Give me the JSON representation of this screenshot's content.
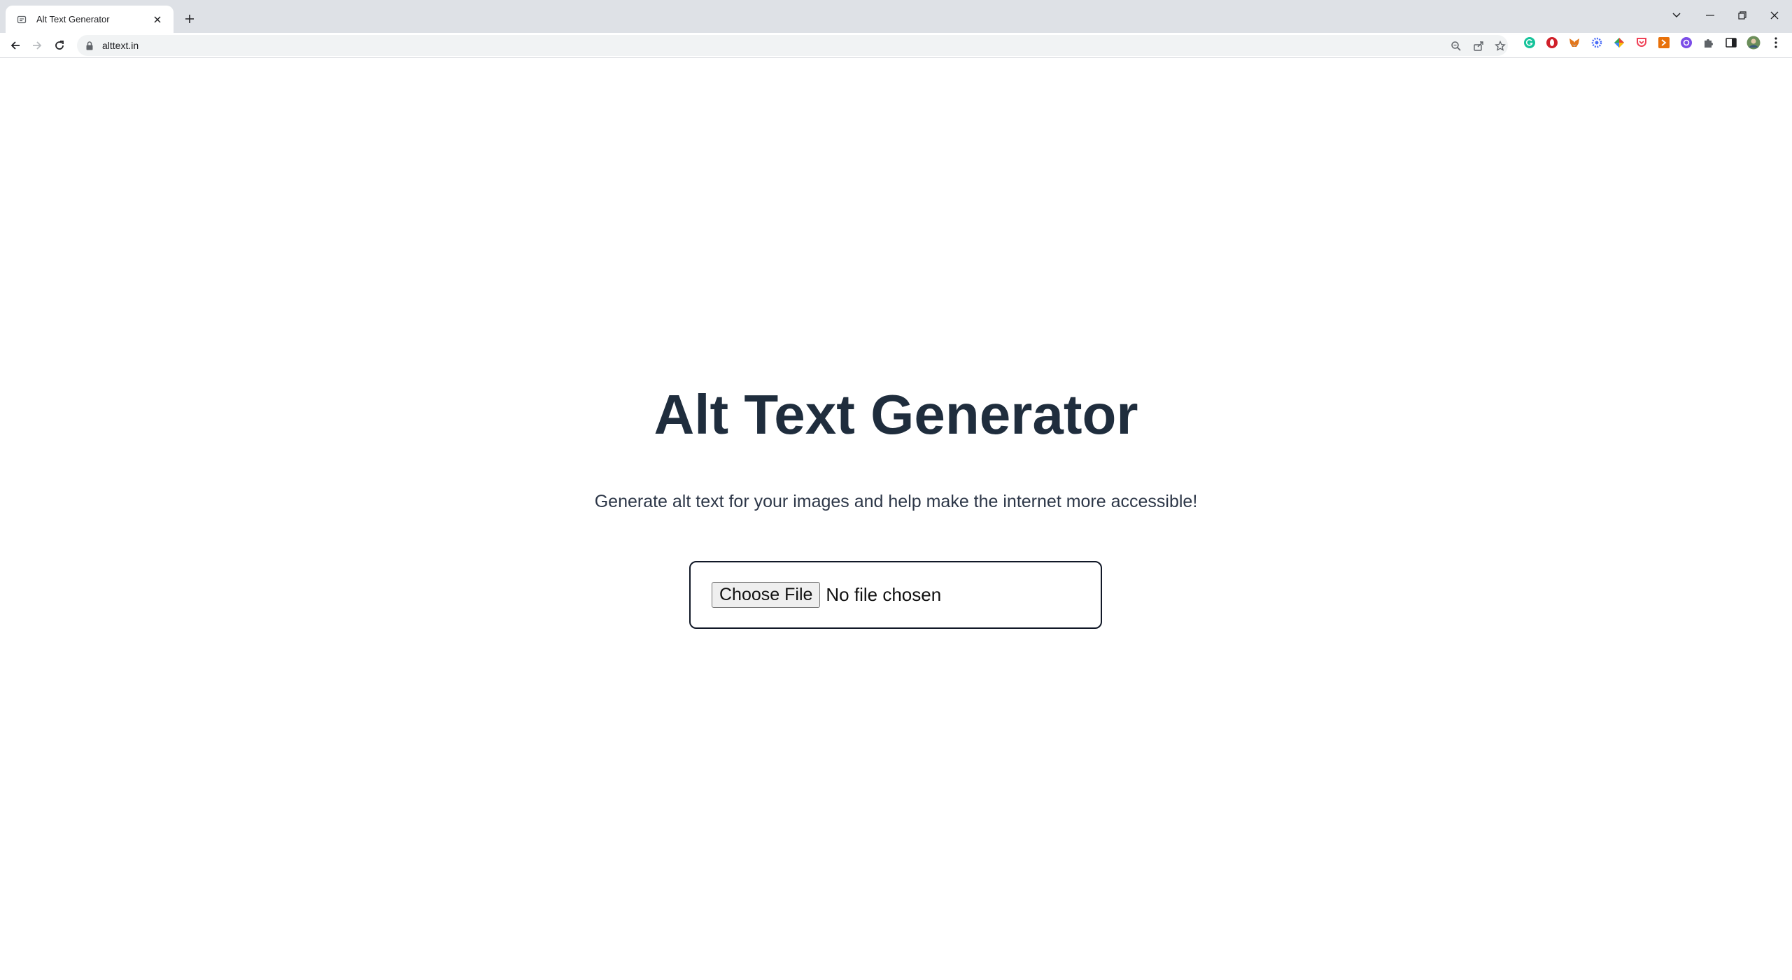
{
  "browser": {
    "tab_title": "Alt Text Generator",
    "url": "alttext.in"
  },
  "page": {
    "title": "Alt Text Generator",
    "subtitle": "Generate alt text for your images and help make the internet more accessible!",
    "file_button_label": "Choose File",
    "file_status": "No file chosen"
  },
  "colors": {
    "title": "#1f2d3d",
    "subtitle": "#2d3748",
    "chrome_bg": "#dee1e6",
    "omnibox_bg": "#f1f3f4"
  }
}
